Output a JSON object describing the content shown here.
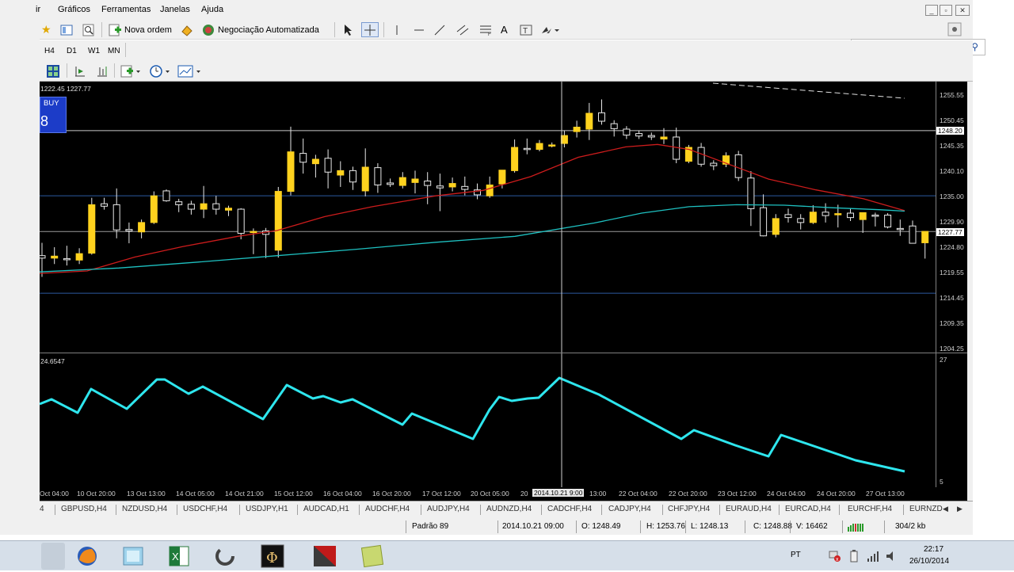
{
  "menu": {
    "items": [
      "ir",
      "Gráficos",
      "Ferramentas",
      "Janelas",
      "Ajuda"
    ]
  },
  "toolbar": {
    "new_order_label": "Nova ordem",
    "auto_trading_label": "Negociação Automatizada",
    "text_tool_label": "A"
  },
  "timeframes": [
    "H4",
    "D1",
    "W1",
    "MN"
  ],
  "chart": {
    "ohlc_header": "1222.45 1227.77",
    "buy_label": "BUY",
    "buy_digit": "8",
    "price_labels": [
      "1255.55",
      "1250.45",
      "1245.35",
      "1240.10",
      "1235.00",
      "1229.90",
      "1224.80",
      "1219.55",
      "1214.45",
      "1209.35",
      "1204.25"
    ],
    "line_price_tag": "1248.20",
    "current_price_tag": "1227.77",
    "indicator_value": "24.6547",
    "indicator_scale_top": "27",
    "indicator_scale_bottom": "5",
    "crosshair_time": "2014.10.21 9:00",
    "x_labels": [
      "Oct 04:00",
      "10 Oct 20:00",
      "13 Oct 13:00",
      "14 Oct 05:00",
      "14 Oct 21:00",
      "15 Oct 12:00",
      "16 Oct 04:00",
      "16 Oct 20:00",
      "17 Oct 12:00",
      "20 Oct 05:00",
      "20",
      "13:00",
      "22 Oct 04:00",
      "22 Oct 20:00",
      "23 Oct 12:00",
      "24 Oct 04:00",
      "24 Oct 20:00",
      "27 Oct 13:00"
    ],
    "colors": {
      "bull": "#ffd21e",
      "bear": "#000000",
      "ma_red": "#cc1c1c",
      "ma_teal": "#1ec0c0",
      "indicator": "#2ee6ee",
      "hline": "#9a9a9a",
      "hline_blue": "#2c5aa0"
    }
  },
  "symbol_tabs": [
    "GBPUSD,H4",
    "NZDUSD,H4",
    "USDCHF,H4",
    "USDJPY,H1",
    "AUDCAD,H1",
    "AUDCHF,H4",
    "AUDJPY,H4",
    "AUDNZD,H4",
    "CADCHF,H4",
    "CADJPY,H4",
    "CHFJPY,H4",
    "EURAUD,H4",
    "EURCAD,H4",
    "EURCHF,H4",
    "EURNZD"
  ],
  "status": {
    "profile": "Padrão 89",
    "datetime": "2014.10.21 09:00",
    "open": "O: 1248.49",
    "high": "H: 1253.76",
    "low": "L: 1248.13",
    "close": "C: 1248.88",
    "volume": "V: 16462",
    "traffic": "304/2 kb"
  },
  "taskbar": {
    "lang": "PT",
    "time": "22:17",
    "date": "26/10/2014"
  }
}
